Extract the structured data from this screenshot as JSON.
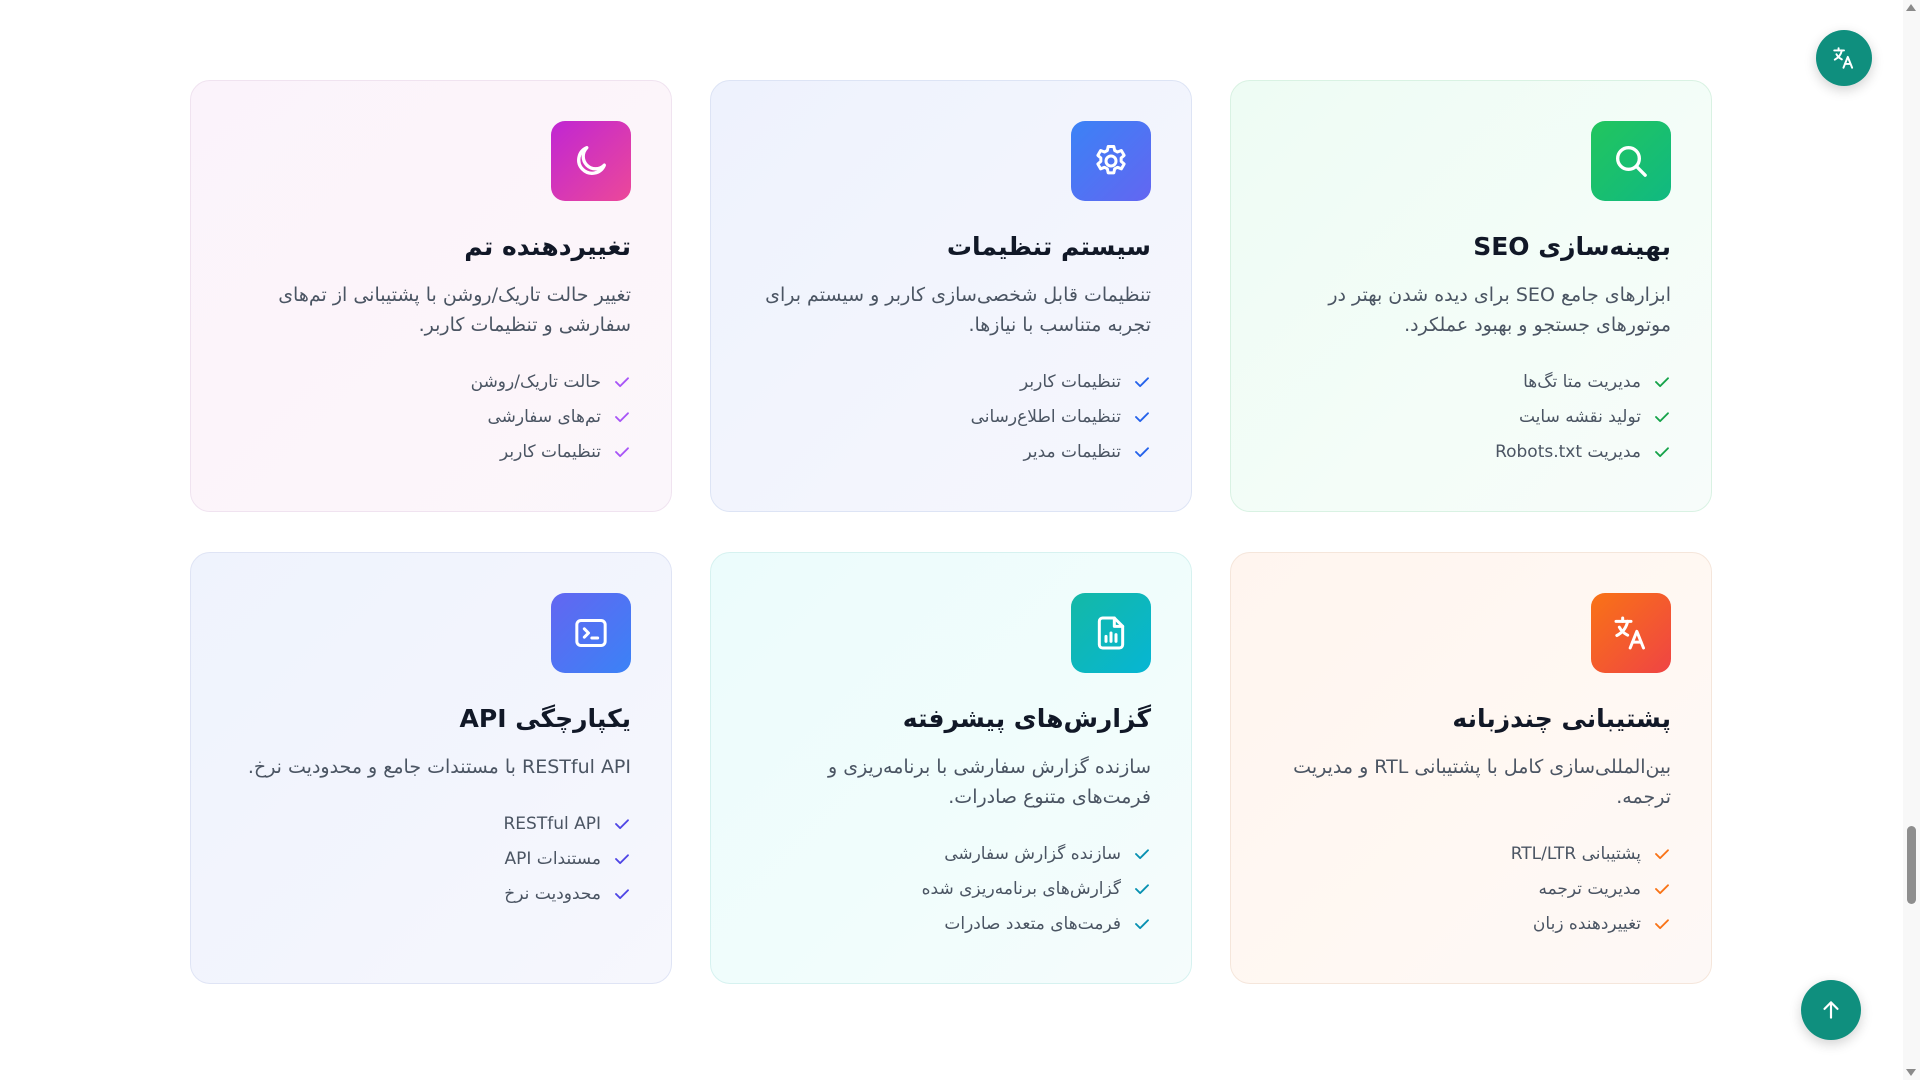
{
  "colors": {
    "accent": "#0f8f7e",
    "check_seo": "#16a34a",
    "check_settings": "#2563eb",
    "check_theme": "#a855f7",
    "check_i18n": "#f97316",
    "check_reports": "#0891b2",
    "check_api": "#4f46e5"
  },
  "floating": {
    "translate_icon": "translate-icon",
    "top_icon": "arrow-up-icon"
  },
  "cards": [
    {
      "id": "seo",
      "icon": "search-icon",
      "title": "بهینه‌سازی SEO",
      "description": "ابزارهای جامع SEO برای دیده شدن بهتر در موتورهای جستجو و بهبود عملکرد.",
      "features": [
        "مدیریت متا تگ‌ها",
        "تولید نقشه سایت",
        "مدیریت Robots.txt"
      ]
    },
    {
      "id": "settings",
      "icon": "gear-icon",
      "title": "سیستم تنظیمات",
      "description": "تنظیمات قابل شخصی‌سازی کاربر و سیستم برای تجربه متناسب با نیازها.",
      "features": [
        "تنظیمات کاربر",
        "تنظیمات اطلاع‌رسانی",
        "تنظیمات مدیر"
      ]
    },
    {
      "id": "theme",
      "icon": "moon-icon",
      "title": "تغییردهنده تم",
      "description": "تغییر حالت تاریک/روشن با پشتیبانی از تم‌های سفارشی و تنظیمات کاربر.",
      "features": [
        "حالت تاریک/روشن",
        "تم‌های سفارشی",
        "تنظیمات کاربر"
      ]
    },
    {
      "id": "i18n",
      "icon": "translate-icon",
      "title": "پشتیبانی چندزبانه",
      "description": "بین‌المللی‌سازی کامل با پشتیبانی RTL و مدیریت ترجمه.",
      "features": [
        "پشتیبانی RTL/LTR",
        "مدیریت ترجمه",
        "تغییردهنده زبان"
      ]
    },
    {
      "id": "reports",
      "icon": "report-file-icon",
      "title": "گزارش‌های پیشرفته",
      "description": "سازنده گزارش سفارشی با برنامه‌ریزی و فرمت‌های متنوع صادرات.",
      "features": [
        "سازنده گزارش سفارشی",
        "گزارش‌های برنامه‌ریزی شده",
        "فرمت‌های متعدد صادرات"
      ]
    },
    {
      "id": "api",
      "icon": "terminal-icon",
      "title": "یکپارچگی API",
      "description": "RESTful API با مستندات جامع و محدودیت نرخ.",
      "features": [
        "RESTful API",
        "مستندات API",
        "محدودیت نرخ"
      ]
    }
  ]
}
